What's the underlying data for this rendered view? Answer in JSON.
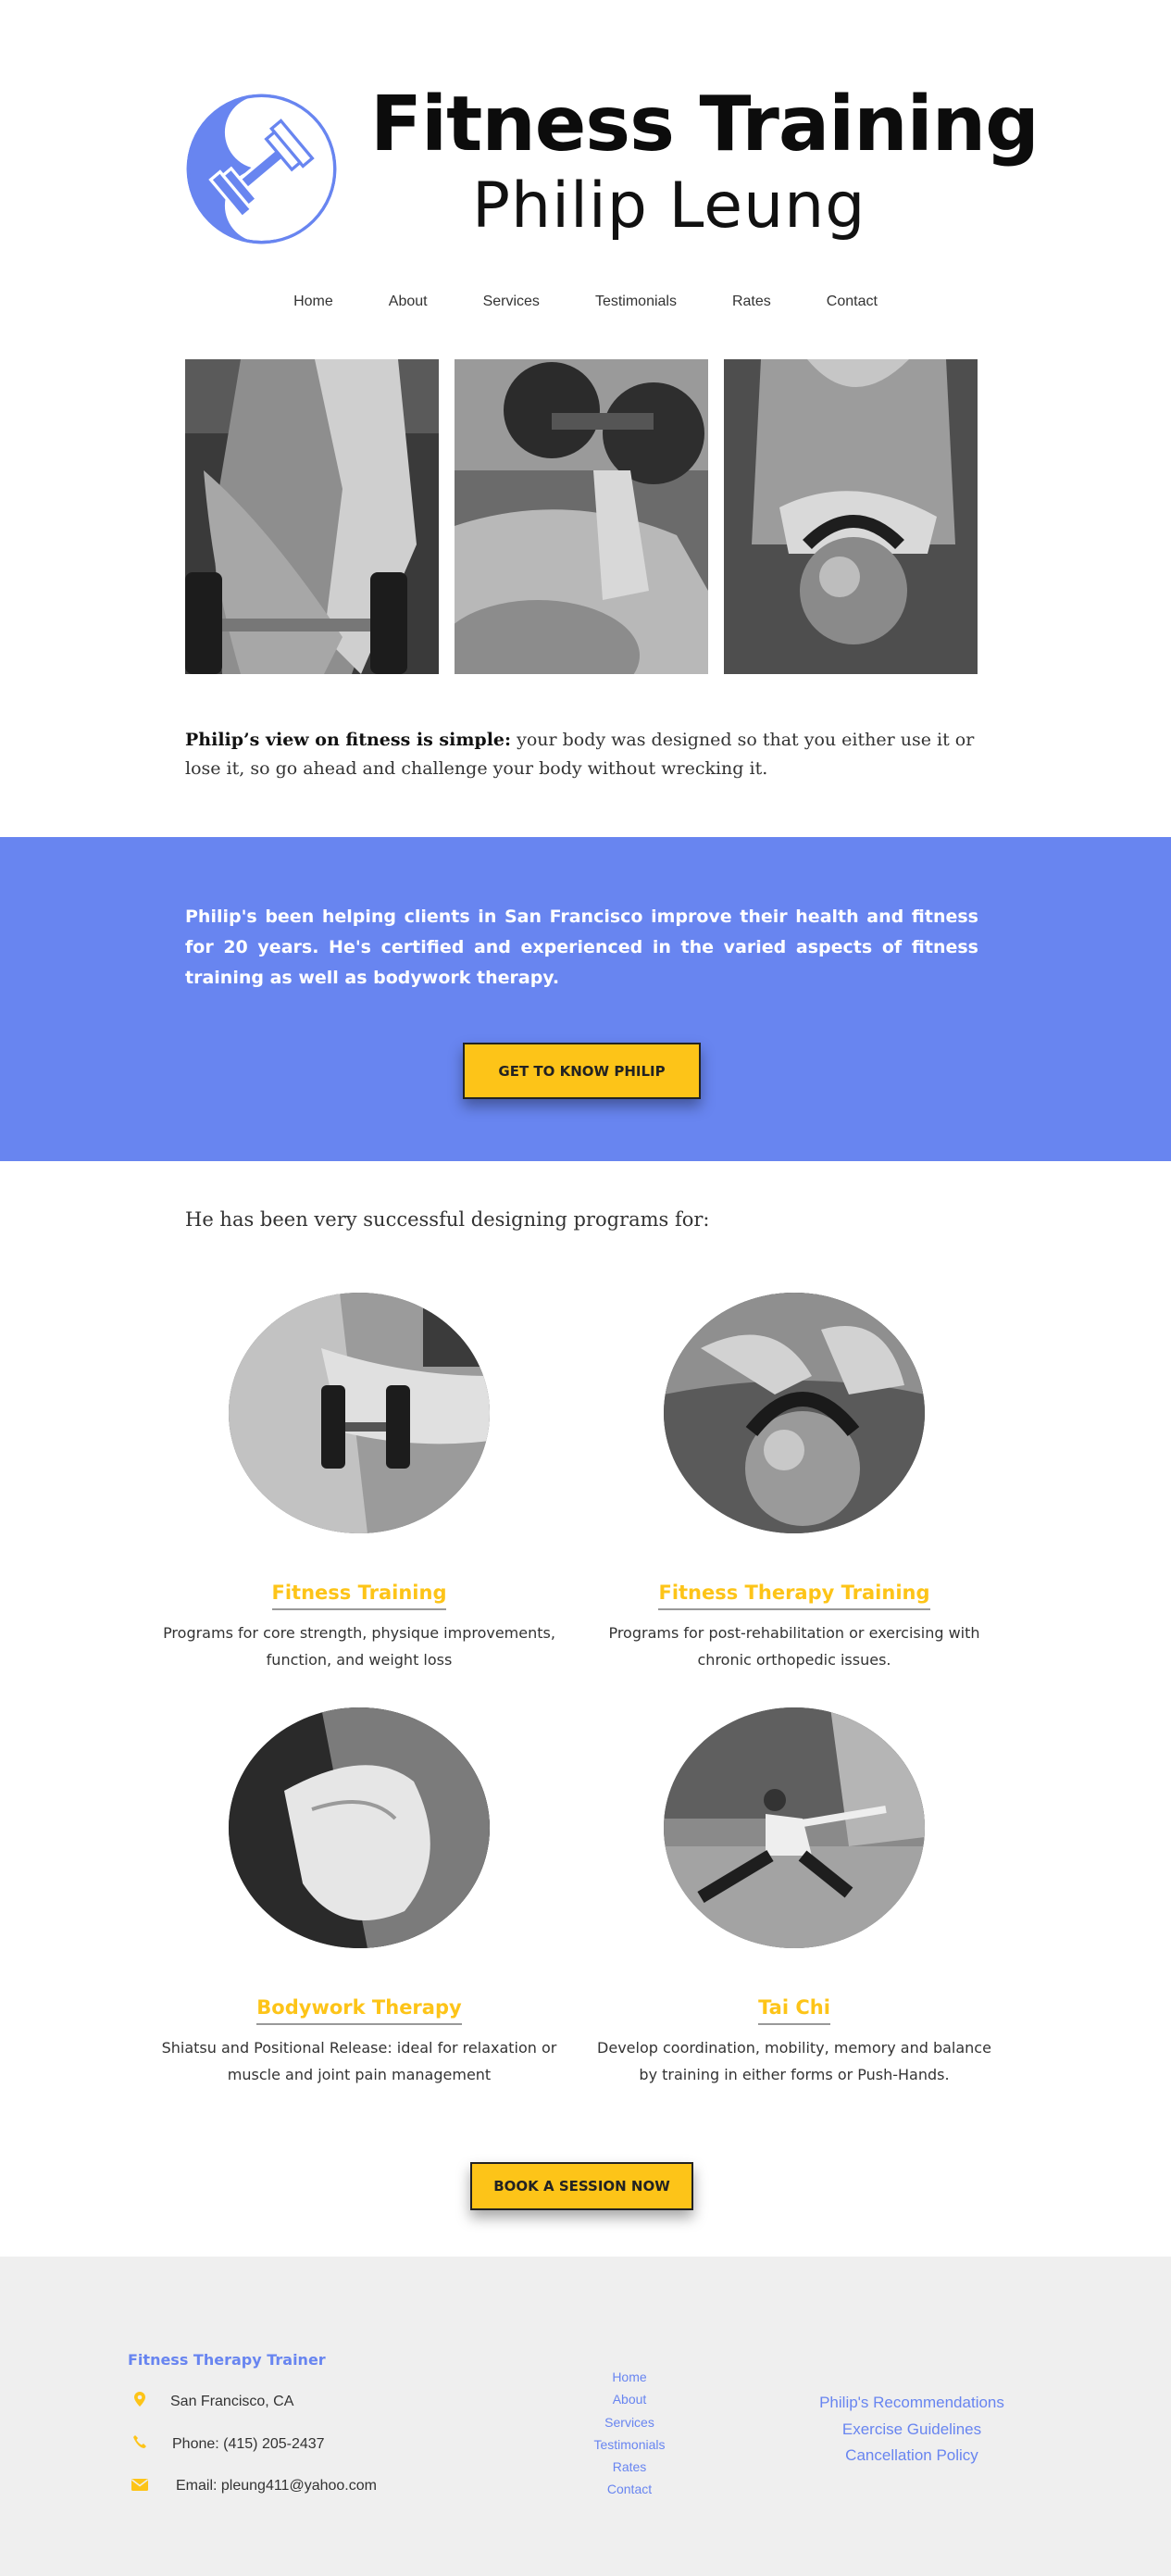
{
  "header": {
    "title": "Fitness Training",
    "subtitle": "Philip Leung"
  },
  "nav": {
    "items": [
      "Home",
      "About",
      "Services",
      "Testimonials",
      "Rates",
      "Contact"
    ]
  },
  "hero": {
    "photos": [
      "arm with dumbbell",
      "dumbbell curl on ball",
      "hands holding kettlebell"
    ]
  },
  "intro": {
    "lead": "Philip’s view on fitness is simple:",
    "text": " your body was designed so that you either use it or lose it, so go ahead and challenge your body without wrecking it."
  },
  "band": {
    "text": "Philip's been helping clients in San Francisco improve their health and fitness for 20 years. He's certified and experienced in the varied aspects of fitness training as well as bodywork therapy.",
    "button": "GET TO KNOW PHILIP"
  },
  "programs": {
    "intro": "He has been very successful designing programs for:",
    "items": [
      {
        "title": "Fitness Training",
        "desc": "Programs for core strength, physique improvements, function, and weight loss"
      },
      {
        "title": "Fitness Therapy Training",
        "desc": "Programs for post-rehabilitation or exercising with chronic orthopedic issues."
      },
      {
        "title": "Bodywork Therapy",
        "desc": "Shiatsu and Positional Release: ideal for relaxation or muscle and joint pain management"
      },
      {
        "title": "Tai Chi",
        "desc": "Develop coordination, mobility, memory and balance by training in either forms or Push-Hands."
      }
    ],
    "button": "BOOK A SESSION NOW"
  },
  "footer": {
    "title": "Fitness Therapy Trainer",
    "location": "San Francisco, CA",
    "phone": "Phone: (415) 205-2437",
    "email": "Email: pleung411@yahoo.com",
    "nav": [
      "Home",
      "About",
      "Services",
      "Testimonials",
      "Rates",
      "Contact"
    ],
    "links": [
      "Philip's Recommendations",
      "Exercise Guidelines",
      "Cancellation Policy"
    ],
    "icons": [
      "map-pin-icon",
      "phone-icon",
      "envelope-icon"
    ]
  },
  "colors": {
    "accent_blue": "#6885f0",
    "accent_yellow": "#fdc418",
    "footer_bg": "#efefef"
  }
}
